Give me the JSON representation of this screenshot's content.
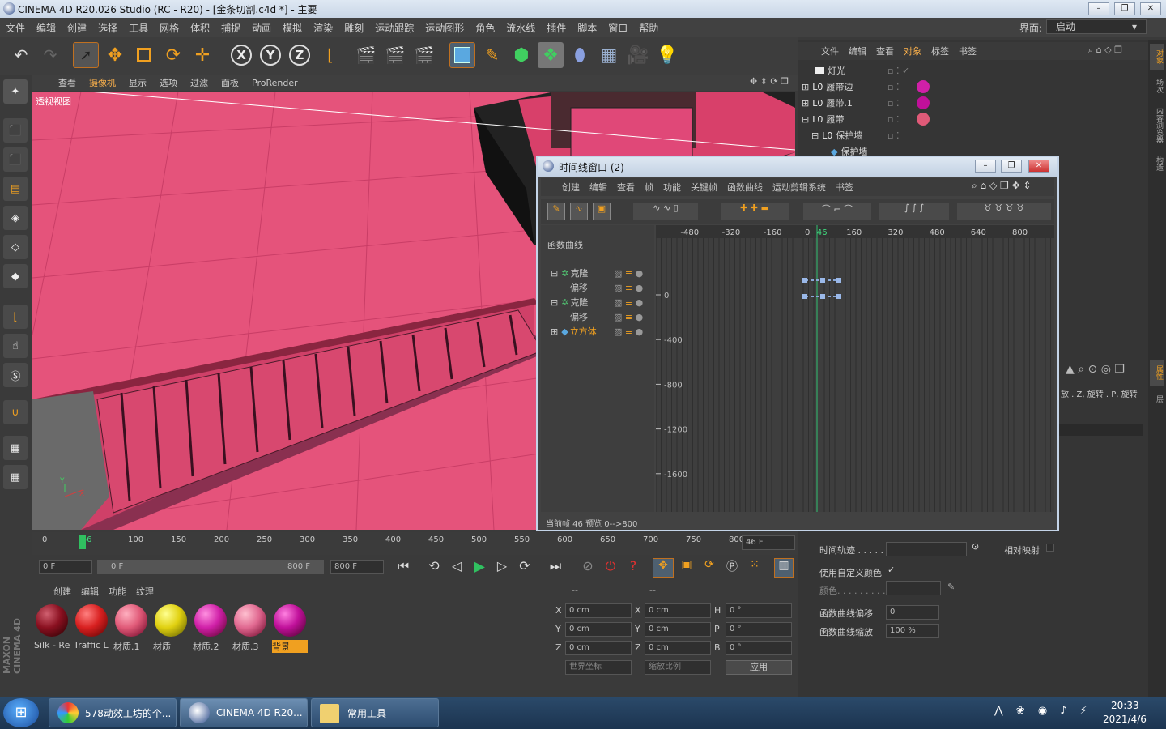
{
  "app": {
    "title": "CINEMA 4D R20.026 Studio (RC - R20) - [金条切割.c4d *] - 主要",
    "layout_label": "界面:",
    "layout_value": "启动"
  },
  "menu": [
    "文件",
    "编辑",
    "创建",
    "选择",
    "工具",
    "网格",
    "体积",
    "捕捉",
    "动画",
    "模拟",
    "渲染",
    "雕刻",
    "运动跟踪",
    "运动图形",
    "角色",
    "流水线",
    "插件",
    "脚本",
    "窗口",
    "帮助"
  ],
  "toolbar": {
    "axes": [
      "X",
      "Y",
      "Z"
    ]
  },
  "viewport": {
    "menu": [
      "查看",
      "摄像机",
      "显示",
      "选项",
      "过滤",
      "面板",
      "ProRender"
    ],
    "label": "透视视图",
    "axis_y": "Y",
    "axis_x": "X"
  },
  "timeline": {
    "ticks": [
      "0",
      "46",
      "100",
      "150",
      "200",
      "250",
      "300",
      "350",
      "400",
      "450",
      "500",
      "550",
      "600",
      "650",
      "700",
      "750",
      "800"
    ],
    "current": "46 F"
  },
  "transport": {
    "start": "0 F",
    "range_start": "0 F",
    "range_end": "800 F",
    "end": "800 F"
  },
  "materials": {
    "menu": [
      "创建",
      "编辑",
      "功能",
      "纹理"
    ],
    "items": [
      {
        "name": "Silk - Re",
        "color": "#8a1020"
      },
      {
        "name": "Traffic L",
        "color": "#d82020"
      },
      {
        "name": "材质.1",
        "color": "#e05a78"
      },
      {
        "name": "材质",
        "color": "#e0d010"
      },
      {
        "name": "材质.2",
        "color": "#d020a8"
      },
      {
        "name": "材质.3",
        "color": "#e06890"
      },
      {
        "name": "背景",
        "color": "#c0109a"
      }
    ]
  },
  "coords": {
    "header1": "--",
    "header2": "--",
    "rows": [
      {
        "a": "X",
        "av": "0 cm",
        "b": "X",
        "bv": "0 cm",
        "c": "H",
        "cv": "0 °"
      },
      {
        "a": "Y",
        "av": "0 cm",
        "b": "Y",
        "bv": "0 cm",
        "c": "P",
        "cv": "0 °"
      },
      {
        "a": "Z",
        "av": "0 cm",
        "b": "Z",
        "bv": "0 cm",
        "c": "B",
        "cv": "0 °"
      }
    ],
    "world": "世界坐标",
    "scale": "缩放比例",
    "apply": "应用"
  },
  "objects": {
    "menu": [
      "文件",
      "编辑",
      "查看",
      "对象",
      "标签",
      "书签"
    ],
    "items": [
      {
        "name": "灯光",
        "indent": 0
      },
      {
        "name": "履带边",
        "indent": 0
      },
      {
        "name": "履带.1",
        "indent": 0
      },
      {
        "name": "履带",
        "indent": 0
      },
      {
        "name": "保护墙",
        "indent": 1
      },
      {
        "name": "保护墙",
        "indent": 2
      }
    ]
  },
  "attributes": {
    "partial": "放 . Z, 旋转 . P, 旋转",
    "time_track": "时间轨迹 . . . . .",
    "relative": "相对映射",
    "use_color": "使用自定义颜色",
    "color": "颜色. . . . . . . . .",
    "curve_offset": "函数曲线偏移",
    "curve_offset_val": "0",
    "curve_scale": "函数曲线缩放",
    "curve_scale_val": "100 %"
  },
  "right_tabs": [
    "对象",
    "场次",
    "内容浏览器",
    "构造"
  ],
  "right_tabs2": [
    "属性",
    "层"
  ],
  "tlwindow": {
    "title": "时间线窗口 (2)",
    "menu": [
      "创建",
      "编辑",
      "查看",
      "帧",
      "功能",
      "关键帧",
      "函数曲线",
      "运动剪辑系统",
      "书签"
    ],
    "mode": "函数曲线",
    "tree": [
      {
        "name": "克隆",
        "sub": false
      },
      {
        "name": "偏移",
        "sub": true
      },
      {
        "name": "克隆",
        "sub": false
      },
      {
        "name": "偏移",
        "sub": true
      },
      {
        "name": "立方体",
        "sub": false
      }
    ],
    "xticks": [
      "-480",
      "-320",
      "-160",
      "0",
      "46",
      "160",
      "320",
      "480",
      "640",
      "800"
    ],
    "yticks": [
      "0",
      "-400",
      "-800",
      "-1200",
      "-1600"
    ],
    "status": "当前帧  46  预览  0-->800"
  },
  "taskbar": {
    "items": [
      "578动效工坊的个...",
      "CINEMA 4D R20...",
      "常用工具"
    ],
    "time": "20:33",
    "date": "2021/4/6"
  }
}
